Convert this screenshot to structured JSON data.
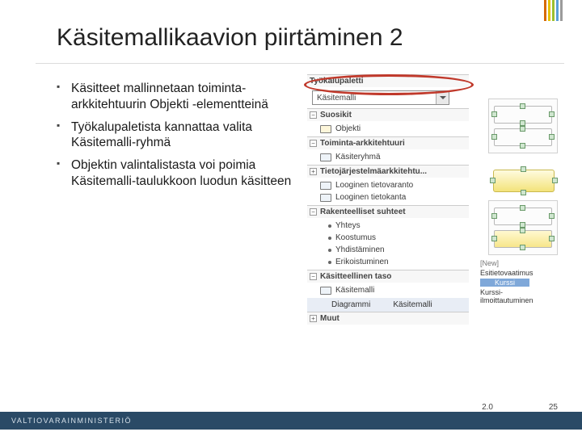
{
  "logo_colors": [
    "#d66a00",
    "#e6c100",
    "#9bbf2e",
    "#5aa0d8",
    "#9b9b9b"
  ],
  "title": "Käsitemallikaavion piirtäminen 2",
  "bullets": [
    "Käsitteet mallinnetaan toiminta-arkkitehtuurin Objekti -elementteinä",
    "Työkalupaletista kannattaa valita Käsitemalli-ryhmä",
    "Objektin valintalistasta voi poimia Käsitemalli-taulukkoon luodun käsitteen"
  ],
  "palette": {
    "header": "Työkalupaletti",
    "dropdown": "Käsitemalli",
    "groups": [
      {
        "toggle": "−",
        "label": "Suosikit",
        "items": [
          {
            "text": "Objekti",
            "pale": true
          }
        ]
      },
      {
        "toggle": "−",
        "label": "Toiminta-arkkitehtuuri",
        "items": [
          {
            "text": "Käsiteryhmä"
          }
        ]
      },
      {
        "toggle": "+",
        "label": "Tietojärjestelmäarkkitehtu...",
        "items": [
          {
            "text": "Looginen tietovaranto"
          },
          {
            "text": "Looginen tietokanta"
          }
        ]
      },
      {
        "toggle": "−",
        "label": "Rakenteelliset suhteet",
        "items": [],
        "subitems": [
          "Yhteys",
          "Koostumus",
          "Yhdistäminen",
          "Erikoistuminen"
        ]
      },
      {
        "toggle": "−",
        "label": "Käsitteellinen taso",
        "items": [
          {
            "text": "Käsitemalli"
          }
        ]
      }
    ],
    "bottom_row": {
      "left": "Diagrammi",
      "right": "Käsitemalli"
    },
    "footer": {
      "toggle": "+",
      "label": "Muut"
    }
  },
  "callout": {
    "new": "[New]",
    "opt1": "Esitietovaatimus",
    "selected": "Kurssi",
    "opt2": "Kurssi-ilmoittautuminen"
  },
  "footer": {
    "ministry": "VALTIOVARAINMINISTERIÖ",
    "version": "2.0",
    "page": "25"
  }
}
